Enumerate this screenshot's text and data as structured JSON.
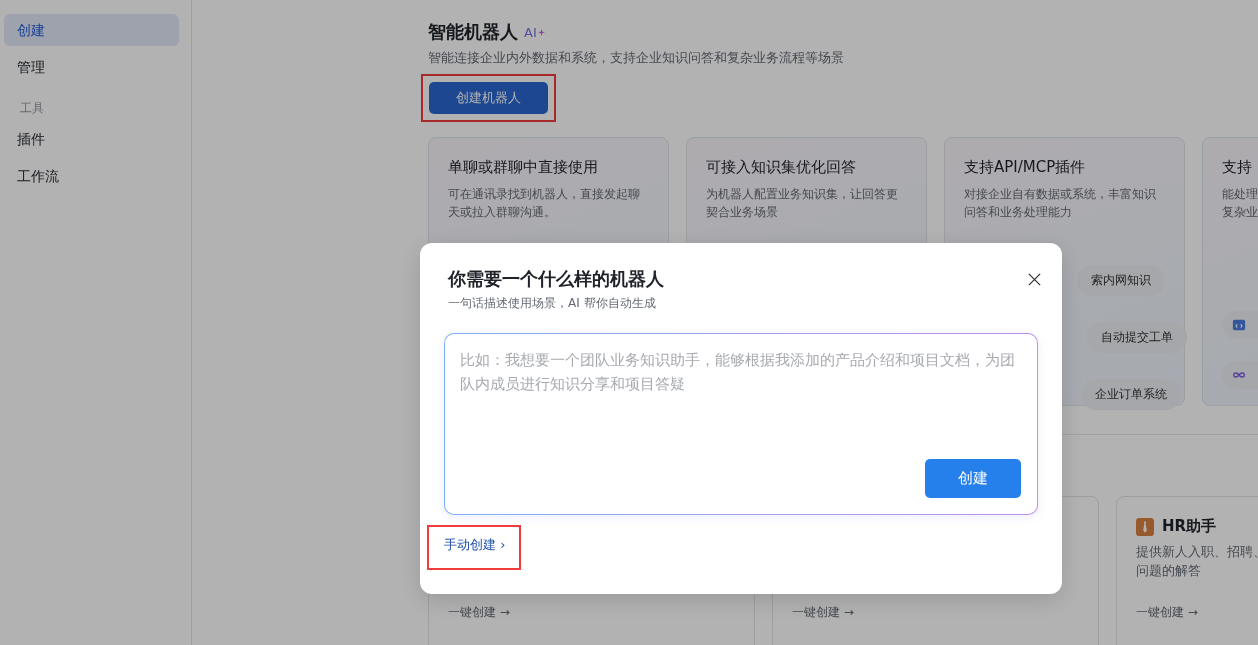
{
  "sidebar": {
    "items": [
      {
        "kind": "item",
        "label": "创建",
        "selected": true
      },
      {
        "kind": "item",
        "label": "管理",
        "selected": false
      },
      {
        "kind": "section",
        "label": "工具"
      },
      {
        "kind": "item",
        "label": "插件",
        "selected": false
      },
      {
        "kind": "item",
        "label": "工作流",
        "selected": false
      }
    ]
  },
  "header": {
    "title": "智能机器人",
    "badge": "AI",
    "subtitle": "智能连接企业内外数据和系统，支持企业知识问答和复杂业务流程等场景",
    "create_button": {
      "label": "创建机器人",
      "highlighted": true
    }
  },
  "features": [
    {
      "title": "单聊或群聊中直接使用",
      "desc": "可在通讯录找到机器人，直接发起聊天或拉入群聊沟通。"
    },
    {
      "title": "可接入知识集优化回答",
      "desc": "为机器人配置业务知识集，让回答更契合业务场景"
    },
    {
      "title": "支持API/MCP插件",
      "desc": "对接企业自有数据或系统，丰富知识问答和业务处理能力",
      "chips": [
        {
          "text": "索内网知识"
        },
        {
          "text": "自动提交工单"
        },
        {
          "text": "企业订单系统"
        }
      ]
    },
    {
      "title": "支持",
      "desc_lines": [
        "能处理",
        "复杂业"
      ],
      "chips": [
        {
          "kind": "code"
        },
        {
          "kind": "infinity"
        }
      ]
    }
  ],
  "templates": [
    {
      "action": "一键创建 →"
    },
    {
      "action": "一键创建 →"
    },
    {
      "title": "HR助手",
      "desc_lines": [
        "提供新人入职、招聘、",
        "问题的解答"
      ],
      "action": "一键创建 →"
    }
  ],
  "dialog": {
    "title": "你需要一个什么样的机器人",
    "subtitle": "一句话描述使用场景，AI 帮你自动生成",
    "placeholder": "比如：我想要一个团队业务知识助手，能够根据我添加的产品介绍和项目文档，为团队内成员进行知识分享和项目答疑",
    "submit": "创建",
    "manual_link": {
      "label": "手动创建 ›",
      "highlighted": true
    }
  }
}
